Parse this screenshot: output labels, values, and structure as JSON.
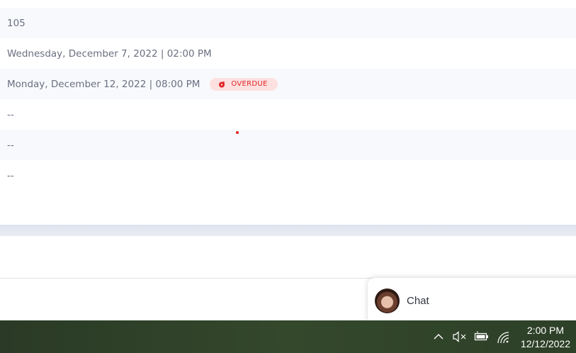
{
  "rows": [
    {
      "text": "105"
    },
    {
      "text": "Wednesday, December 7, 2022 | 02:00 PM"
    },
    {
      "text": "Monday, December 12, 2022 | 08:00 PM",
      "badge": "OVERDUE"
    },
    {
      "text": "--"
    },
    {
      "text": "--"
    },
    {
      "text": "--"
    }
  ],
  "chat": {
    "label": "Chat"
  },
  "taskbar": {
    "time": "2:00 PM",
    "date": "12/12/2022"
  },
  "colors": {
    "overdue": "#e02424",
    "overdue_bg": "#fde0e0",
    "text": "#6b6f80",
    "taskbar": "#2f4229"
  },
  "icons": [
    "chevron-up-icon",
    "speaker-muted-icon",
    "battery-icon",
    "wifi-icon"
  ]
}
